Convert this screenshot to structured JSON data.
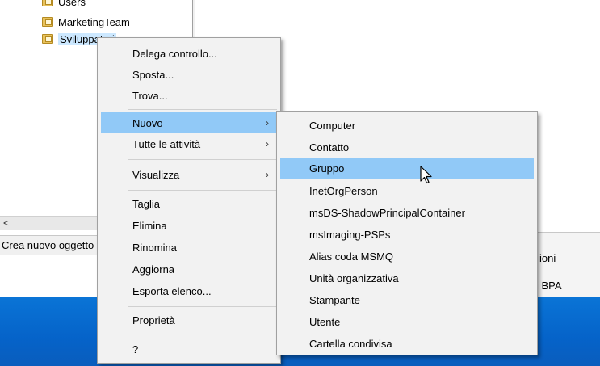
{
  "tree": {
    "items": [
      {
        "label": "Users"
      },
      {
        "label": "MarketingTeam"
      },
      {
        "label": "Sviluppatori"
      }
    ]
  },
  "hscroll": {
    "arrow": "<"
  },
  "status_bar": {
    "text": "Crea nuovo oggetto"
  },
  "right_panel": {
    "line1": "ioni",
    "line2": "i BPA"
  },
  "context_menu": {
    "items": [
      {
        "label": "Delega controllo..."
      },
      {
        "label": "Sposta..."
      },
      {
        "label": "Trova..."
      },
      {
        "label": "Nuovo",
        "submenu": true,
        "highlighted": true
      },
      {
        "label": "Tutte le attività",
        "submenu": true
      },
      {
        "label": "Visualizza",
        "submenu": true
      },
      {
        "label": "Taglia"
      },
      {
        "label": "Elimina"
      },
      {
        "label": "Rinomina"
      },
      {
        "label": "Aggiorna"
      },
      {
        "label": "Esporta elenco..."
      },
      {
        "label": "Proprietà"
      },
      {
        "label": "?"
      }
    ]
  },
  "submenu_nuovo": {
    "items": [
      {
        "label": "Computer"
      },
      {
        "label": "Contatto"
      },
      {
        "label": "Gruppo",
        "highlighted": true
      },
      {
        "label": "InetOrgPerson"
      },
      {
        "label": "msDS-ShadowPrincipalContainer"
      },
      {
        "label": "msImaging-PSPs"
      },
      {
        "label": "Alias coda MSMQ"
      },
      {
        "label": "Unità organizzativa"
      },
      {
        "label": "Stampante"
      },
      {
        "label": "Utente"
      },
      {
        "label": "Cartella condivisa"
      }
    ]
  },
  "glyphs": {
    "chevron_right": "›"
  },
  "colors": {
    "highlight": "#91c9f7",
    "menu_bg": "#f2f2f2",
    "desktop": "#0563c9"
  }
}
